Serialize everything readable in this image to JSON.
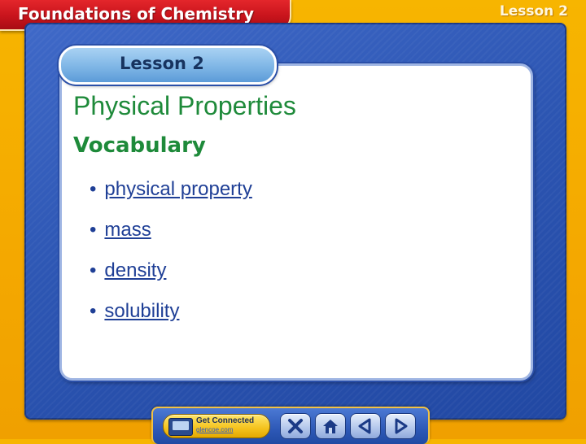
{
  "header": {
    "title": "Foundations of Chemistry",
    "lesson_corner": "Lesson 2"
  },
  "lesson_tab": {
    "label": "Lesson 2"
  },
  "content": {
    "heading": "Physical Properties",
    "subheading": "Vocabulary",
    "terms": [
      {
        "label": "physical property"
      },
      {
        "label": "mass"
      },
      {
        "label": "density"
      },
      {
        "label": "solubility"
      }
    ],
    "bullet": "•"
  },
  "nav": {
    "get_connected_label": "Get Connected",
    "get_connected_url": "glencoe.com",
    "buttons": [
      {
        "icon": "close-icon"
      },
      {
        "icon": "home-icon"
      },
      {
        "icon": "previous-arrow-icon"
      },
      {
        "icon": "next-arrow-icon"
      }
    ]
  },
  "colors": {
    "background_gold": "#f4a800",
    "title_red": "#c8141c",
    "frame_blue": "#2d56b3",
    "heading_green": "#1e8a3a",
    "term_blue": "#1f3f96"
  }
}
